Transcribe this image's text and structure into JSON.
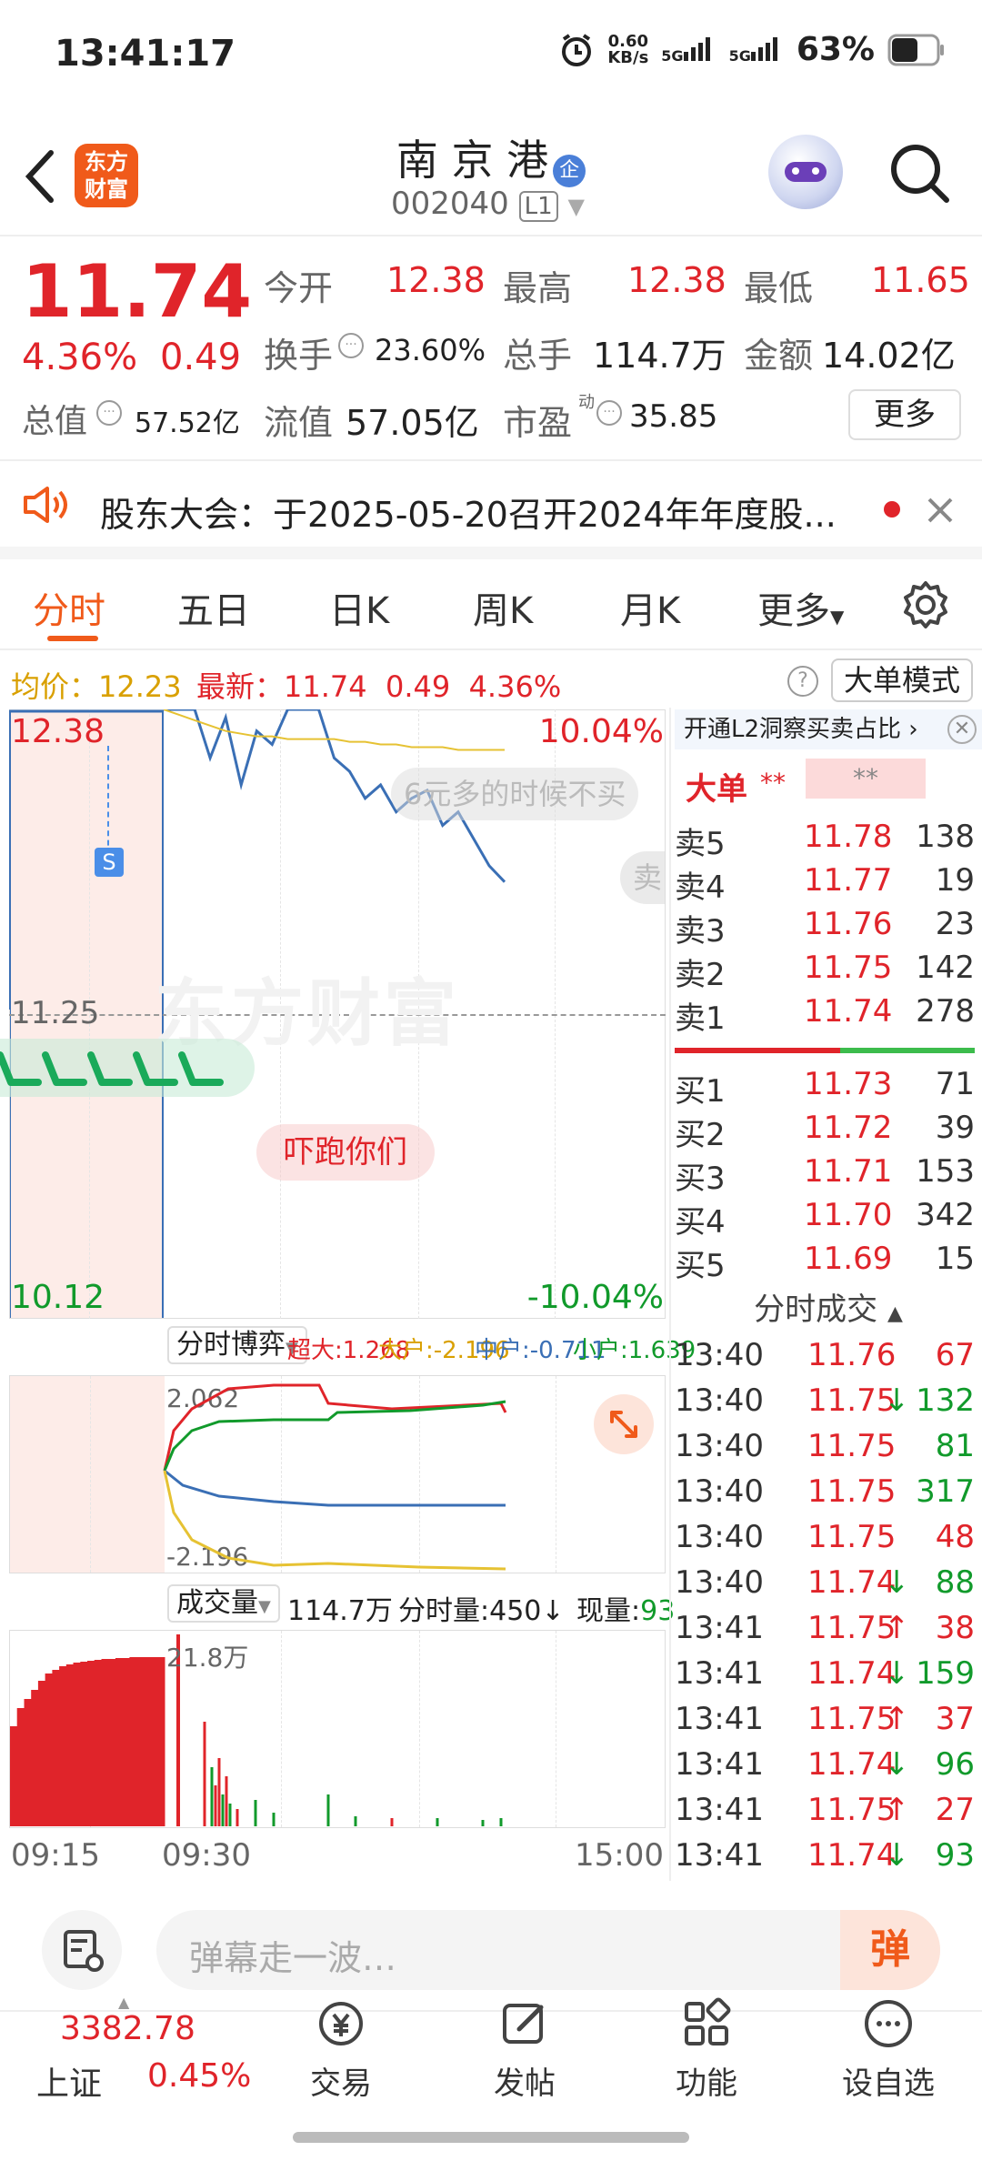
{
  "status_bar": {
    "time": "13:41:17",
    "net_speed": "0.60",
    "net_unit": "KB/s",
    "sim1": "5G",
    "sim2": "5G",
    "battery": "63%"
  },
  "header": {
    "logo_text_1": "东方",
    "logo_text_2": "财富",
    "stock_name": "南 京 港",
    "badge": "企",
    "code": "002040",
    "level": "L1"
  },
  "quote": {
    "price": "11.74",
    "change_pct": "4.36%",
    "change": "0.49",
    "open_label": "今开",
    "open": "12.38",
    "high_label": "最高",
    "high": "12.38",
    "low_label": "最低",
    "low": "11.65",
    "turnover_label": "换手",
    "turnover": "23.60%",
    "volume_label": "总手",
    "volume": "114.7万",
    "amount_label": "金额",
    "amount": "14.02亿",
    "mktcap_label": "总值",
    "mktcap": "57.52亿",
    "float_label": "流值",
    "float": "57.05亿",
    "pe_label": "市盈",
    "pe_sup": "动",
    "pe": "35.85",
    "more": "更多"
  },
  "announcement": {
    "text": "股东大会：于2025-05-20召开2024年年度股..."
  },
  "tabs": [
    "分时",
    "五日",
    "日K",
    "周K",
    "月K",
    "更多"
  ],
  "indicator": {
    "avg_label": "均价：",
    "avg": "12.23",
    "last_label": "最新：",
    "last": "11.74",
    "chg": "0.49",
    "pct": "4.36%",
    "big_order_mode": "大单模式"
  },
  "chart": {
    "top_price": "12.38",
    "top_pct": "10.04%",
    "mid_price": "11.25",
    "bottom_price": "10.12",
    "bottom_pct": "-10.04%",
    "danmaku_1": "6元多的时候不买",
    "danmaku_2": "吓跑你们",
    "danmaku_3": "卖",
    "watermark": "东方财富",
    "signal": "S"
  },
  "chart_data": [
    {
      "type": "line",
      "title": "分时",
      "ylim": [
        10.12,
        12.38
      ],
      "series": [
        {
          "values": [
            12.38,
            12.38,
            12.38,
            12.2,
            12.35,
            12.1,
            12.3,
            12.25,
            12.38,
            12.38,
            12.38,
            12.2,
            12.15,
            12.05,
            12.1,
            12.0,
            12.05,
            12.08,
            11.95,
            12.0,
            11.9,
            11.8,
            11.74
          ]
        },
        {
          "values": [
            12.38,
            12.36,
            12.34,
            12.32,
            12.3,
            12.29,
            12.28,
            12.28,
            12.27,
            12.27,
            12.27,
            12.27,
            12.26,
            12.26,
            12.25,
            12.25,
            12.24,
            12.24,
            12.24,
            12.23,
            12.23,
            12.23,
            12.23
          ]
        }
      ]
    },
    {
      "type": "line",
      "title": "分时博弈",
      "ylim": [
        -2.196,
        2.062
      ],
      "series": [
        {
          "name": "超大",
          "value": "1.268"
        },
        {
          "name": "大户",
          "value": "-2.196"
        },
        {
          "name": "中户",
          "value": "-0.711"
        },
        {
          "name": "小户",
          "value": "1.639"
        }
      ]
    },
    {
      "type": "bar",
      "title": "成交量",
      "total": "114.7万",
      "max_label": "21.8万",
      "time_label": "分时量:450",
      "now_label": "现量:",
      "now": "93",
      "x_ticks": [
        "09:15",
        "09:30",
        "15:00"
      ]
    }
  ],
  "sub_chart": {
    "label": "分时博弈",
    "super": "超大:1.268",
    "big": "大户:-2.196",
    "mid": "中户:-0.711",
    "small": "小户:1.639",
    "max": "2.062",
    "min": "-2.196"
  },
  "vol_chart": {
    "label": "成交量",
    "total": "114.7万",
    "time_vol": "分时量:450",
    "now_label": "现量:",
    "now": "93",
    "peak": "21.8万",
    "t1": "09:15",
    "t2": "09:30",
    "t3": "15:00"
  },
  "orderbook": {
    "promo": "开通L2洞察买卖占比",
    "big_label": "大单",
    "big_val1": "**",
    "big_val2": "**",
    "asks": [
      {
        "label": "卖5",
        "price": "11.78",
        "vol": "138"
      },
      {
        "label": "卖4",
        "price": "11.77",
        "vol": "19"
      },
      {
        "label": "卖3",
        "price": "11.76",
        "vol": "23"
      },
      {
        "label": "卖2",
        "price": "11.75",
        "vol": "142"
      },
      {
        "label": "卖1",
        "price": "11.74",
        "vol": "278"
      }
    ],
    "bids": [
      {
        "label": "买1",
        "price": "11.73",
        "vol": "71"
      },
      {
        "label": "买2",
        "price": "11.72",
        "vol": "39"
      },
      {
        "label": "买3",
        "price": "11.71",
        "vol": "153"
      },
      {
        "label": "买4",
        "price": "11.70",
        "vol": "342"
      },
      {
        "label": "买5",
        "price": "11.69",
        "vol": "15"
      }
    ],
    "trades_title": "分时成交",
    "trades": [
      {
        "time": "13:40",
        "price": "11.76",
        "vol": "67",
        "arrow": "",
        "vc": "red"
      },
      {
        "time": "13:40",
        "price": "11.75",
        "vol": "132",
        "arrow": "↓",
        "vc": "green"
      },
      {
        "time": "13:40",
        "price": "11.75",
        "vol": "81",
        "arrow": "",
        "vc": "green"
      },
      {
        "time": "13:40",
        "price": "11.75",
        "vol": "317",
        "arrow": "",
        "vc": "green"
      },
      {
        "time": "13:40",
        "price": "11.75",
        "vol": "48",
        "arrow": "",
        "vc": "red"
      },
      {
        "time": "13:40",
        "price": "11.74",
        "vol": "88",
        "arrow": "↓",
        "vc": "green"
      },
      {
        "time": "13:41",
        "price": "11.75",
        "vol": "38",
        "arrow": "↑",
        "vc": "red"
      },
      {
        "time": "13:41",
        "price": "11.74",
        "vol": "159",
        "arrow": "↓",
        "vc": "green"
      },
      {
        "time": "13:41",
        "price": "11.75",
        "vol": "37",
        "arrow": "↑",
        "vc": "red"
      },
      {
        "time": "13:41",
        "price": "11.74",
        "vol": "96",
        "arrow": "↓",
        "vc": "green"
      },
      {
        "time": "13:41",
        "price": "11.75",
        "vol": "27",
        "arrow": "↑",
        "vc": "red"
      },
      {
        "time": "13:41",
        "price": "11.74",
        "vol": "93",
        "arrow": "↓",
        "vc": "green"
      }
    ]
  },
  "comment_bar": {
    "placeholder": "弹幕走一波…",
    "danmaku_btn": "弹"
  },
  "bottom_nav": {
    "index_value": "3382.78",
    "index_name": "上证",
    "index_pct": "0.45%",
    "trade": "交易",
    "post": "发帖",
    "func": "功能",
    "watch": "设自选"
  },
  "colors": {
    "red": "#e0242a",
    "green": "#119a2b",
    "blue": "#3a6fb5",
    "yellow": "#e6c233",
    "accent": "#f05a1a"
  }
}
